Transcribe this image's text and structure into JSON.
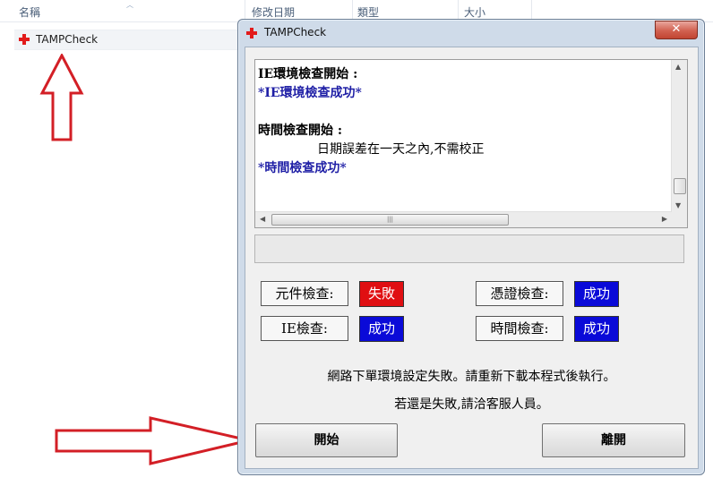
{
  "explorer": {
    "columns": [
      "名稱",
      "修改日期",
      "類型",
      "大小"
    ],
    "file_name": "TAMPCheck"
  },
  "window": {
    "title": "TAMPCheck",
    "close_label": "✕",
    "log_lines": [
      {
        "text": "IE環境檢查開始 :",
        "style": "normal"
      },
      {
        "text": "*IE環境檢查成功*",
        "style": "blue"
      },
      {
        "text": "",
        "style": "normal"
      },
      {
        "text": "時間檢查開始 :",
        "style": "normal"
      },
      {
        "text": "日期誤差在一天之內,不需校正",
        "style": "indent"
      },
      {
        "text": "*時間檢查成功*",
        "style": "blue"
      }
    ],
    "checks": {
      "component": {
        "label": "元件檢查:",
        "result": "失敗",
        "status": "fail"
      },
      "credential": {
        "label": "憑證檢查:",
        "result": "成功",
        "status": "ok"
      },
      "ie": {
        "label": "IE檢查:",
        "result": "成功",
        "status": "ok"
      },
      "time": {
        "label": "時間檢查:",
        "result": "成功",
        "status": "ok"
      }
    },
    "message_1": "網路下單環境設定失敗。請重新下載本程式後執行。",
    "message_2": "若還是失敗,請洽客服人員。",
    "start_button": "開始",
    "exit_button": "離開"
  },
  "colors": {
    "fail": "#e00f12",
    "ok": "#0a0ad8",
    "blue_text": "#1f1fa6",
    "arrow": "#d31f26"
  },
  "icons": [
    "red-cross-icon",
    "close-icon",
    "scroll-up-icon",
    "scroll-down-icon",
    "scroll-left-icon",
    "scroll-right-icon"
  ]
}
